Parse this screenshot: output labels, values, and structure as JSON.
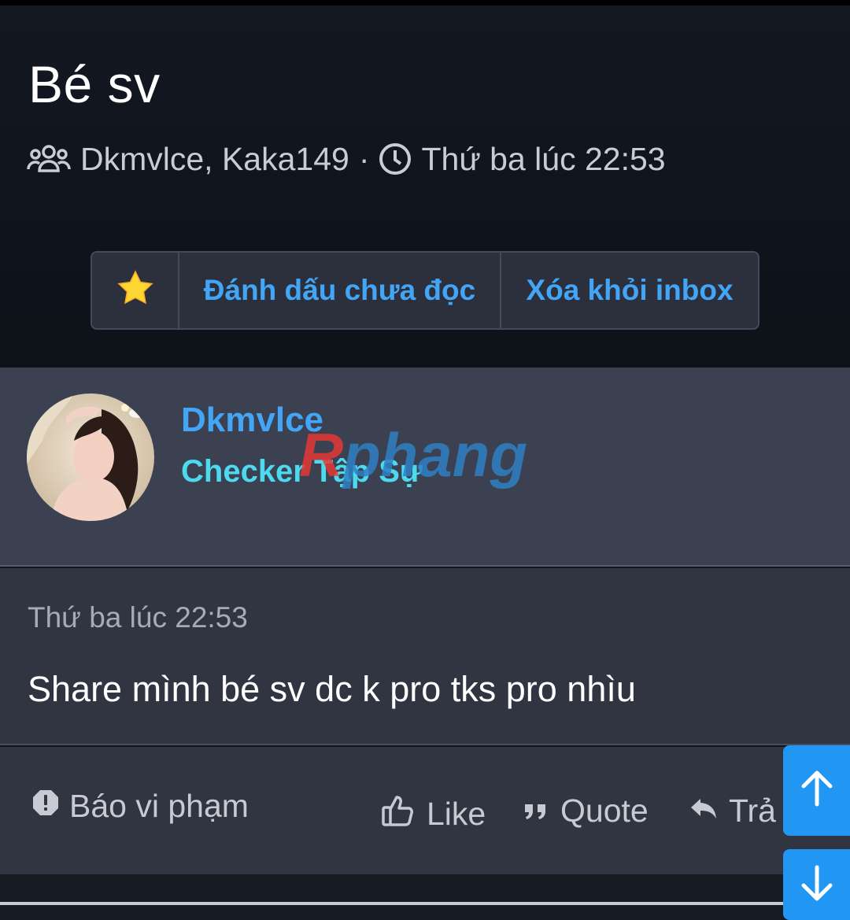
{
  "thread": {
    "title": "Bé sv",
    "participants": "Dkmvlce, Kaka149",
    "separator": "·",
    "time": "Thứ ba lúc 22:53"
  },
  "actions": {
    "star_icon": "star-icon",
    "mark_unread_label": "Đánh dấu chưa đọc",
    "remove_inbox_label": "Xóa khỏi inbox"
  },
  "author": {
    "name": "Dkmvlce",
    "rank": "Checker Tập Sự",
    "watermark": "Rphang"
  },
  "message": {
    "time": "Thứ ba lúc 22:53",
    "body": "Share mình bé sv dc k pro tks pro nhìu"
  },
  "footer": {
    "report_label": "Báo vi phạm",
    "like_label": "Like",
    "quote_label": "Quote",
    "reply_label": "Trả"
  },
  "colors": {
    "accent": "#42a5f5",
    "rank": "#4dd9ee",
    "scroll_button": "#2196f3"
  }
}
